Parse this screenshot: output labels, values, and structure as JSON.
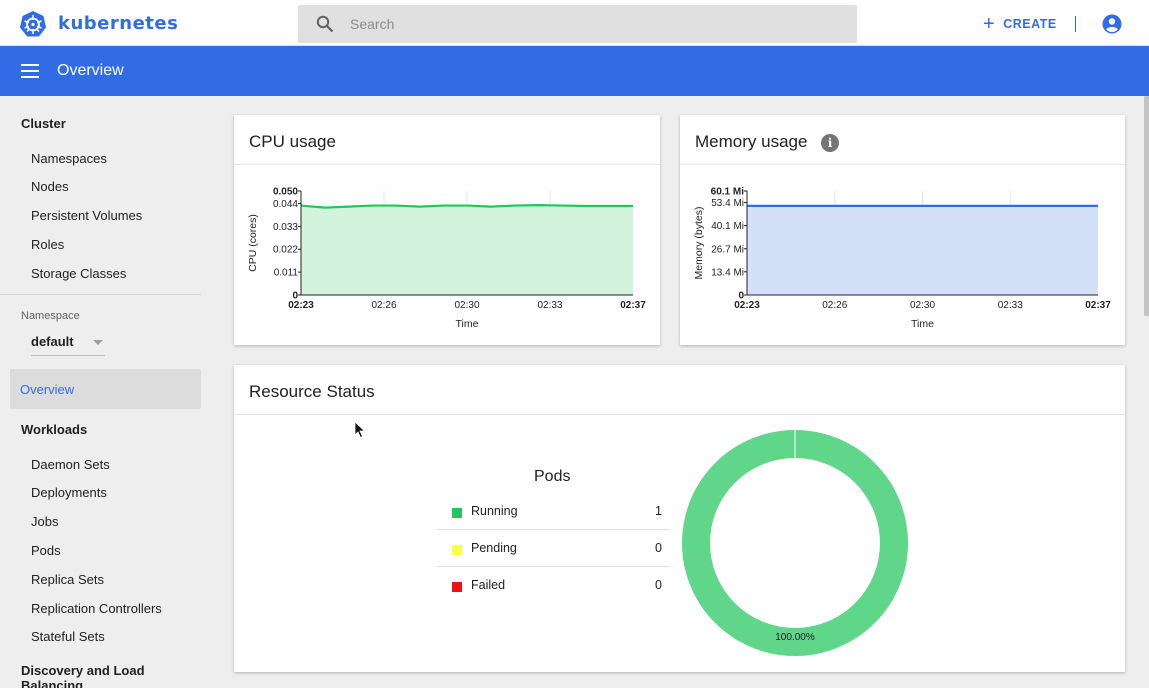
{
  "app": {
    "brand": "kubernetes"
  },
  "search": {
    "placeholder": "Search"
  },
  "toolbar": {
    "create_label": "CREATE"
  },
  "header": {
    "title": "Overview"
  },
  "sidebar": {
    "cluster_label": "Cluster",
    "cluster_items": [
      {
        "label": "Namespaces"
      },
      {
        "label": "Nodes"
      },
      {
        "label": "Persistent Volumes"
      },
      {
        "label": "Roles"
      },
      {
        "label": "Storage Classes"
      }
    ],
    "namespace_label": "Namespace",
    "namespace_value": "default",
    "overview_label": "Overview",
    "workloads_label": "Workloads",
    "workload_items": [
      {
        "label": "Daemon Sets"
      },
      {
        "label": "Deployments"
      },
      {
        "label": "Jobs"
      },
      {
        "label": "Pods"
      },
      {
        "label": "Replica Sets"
      },
      {
        "label": "Replication Controllers"
      },
      {
        "label": "Stateful Sets"
      }
    ],
    "discovery_label": "Discovery and Load Balancing"
  },
  "cpu_card": {
    "title": "CPU usage"
  },
  "memory_card": {
    "title": "Memory usage",
    "info_icon": "i"
  },
  "resource_card": {
    "title": "Resource Status",
    "pods_title": "Pods",
    "rows": [
      {
        "label": "Running",
        "value": "1",
        "color": "#22c55e"
      },
      {
        "label": "Pending",
        "value": "0",
        "color": "#ffff44"
      },
      {
        "label": "Failed",
        "value": "0",
        "color": "#ee1111"
      }
    ],
    "donut_label": "100.00%"
  },
  "colors": {
    "accent": "#326ce5",
    "cpu_line": "#22c55e",
    "cpu_fill": "#d3f3dd",
    "mem_line": "#326ce5",
    "mem_fill": "#d3e0f7",
    "donut": "#5fd68a"
  },
  "chart_data": [
    {
      "type": "area",
      "title": "CPU usage",
      "xlabel": "Time",
      "ylabel": "CPU (cores)",
      "x_ticks": [
        "02:23",
        "02:26",
        "02:30",
        "02:33",
        "02:37"
      ],
      "y_ticks": [
        "0",
        "0.011",
        "0.022",
        "0.033",
        "0.044",
        "0.050"
      ],
      "ylim": [
        0,
        0.05
      ],
      "grid": true,
      "series": [
        {
          "x": [
            0,
            1,
            2,
            3,
            4,
            5,
            6,
            7,
            8,
            9,
            10,
            11,
            12,
            13,
            14
          ],
          "values": [
            0.043,
            0.042,
            0.0425,
            0.043,
            0.043,
            0.0425,
            0.043,
            0.043,
            0.0425,
            0.043,
            0.0432,
            0.043,
            0.0428,
            0.0428,
            0.0428
          ]
        }
      ]
    },
    {
      "type": "area",
      "title": "Memory usage",
      "xlabel": "Time",
      "ylabel": "Memory (bytes)",
      "x_ticks": [
        "02:23",
        "02:26",
        "02:30",
        "02:33",
        "02:37"
      ],
      "y_ticks": [
        "0",
        "13.4 Mi",
        "26.7 Mi",
        "40.1 Mi",
        "53.4 Mi",
        "60.1 Mi"
      ],
      "ylim": [
        0,
        60.1
      ],
      "grid": true,
      "series": [
        {
          "x": [
            0,
            14
          ],
          "values": [
            51.5,
            51.5
          ]
        }
      ]
    },
    {
      "type": "pie",
      "title": "Pods",
      "labels": [
        "Running",
        "Pending",
        "Failed"
      ],
      "values": [
        1,
        0,
        0
      ],
      "annotation": "100.00%"
    }
  ]
}
